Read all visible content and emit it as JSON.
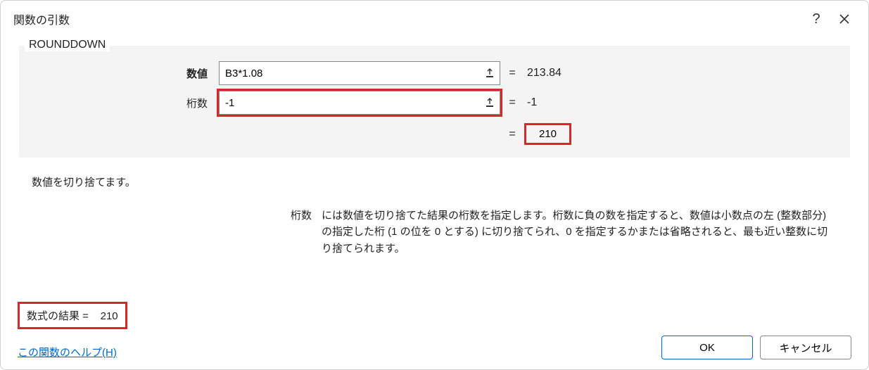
{
  "dialog": {
    "title": "関数の引数",
    "help_symbol": "?",
    "function_name": "ROUNDDOWN"
  },
  "args": {
    "number": {
      "label": "数値",
      "value": "B3*1.08",
      "result": "213.84"
    },
    "digits": {
      "label": "桁数",
      "value": "-1",
      "result": "-1"
    }
  },
  "calc_result": "210",
  "equals": "=",
  "description": {
    "main": "数値を切り捨てます。",
    "arg_name": "桁数",
    "arg_text": "には数値を切り捨てた結果の桁数を指定します。桁数に負の数を指定すると、数値は小数点の左 (整数部分) の指定した桁 (1 の位を 0 とする) に切り捨てられ、0 を指定するかまたは省略されると、最も近い整数に切り捨てられます。"
  },
  "footer": {
    "formula_result_label": "数式の結果 =",
    "formula_result_value": "210",
    "help_link": "この関数のヘルプ(H)",
    "ok": "OK",
    "cancel": "キャンセル"
  }
}
